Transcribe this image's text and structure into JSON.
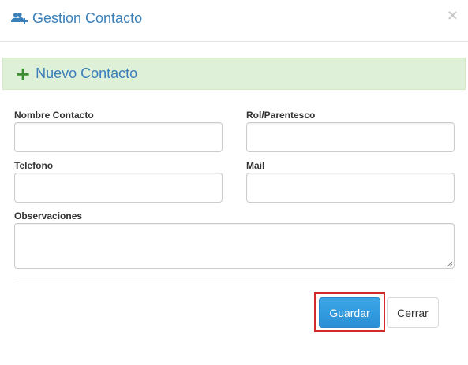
{
  "modal": {
    "title": "Gestion Contacto",
    "title_icon": "add-user-icon",
    "close_label": "×"
  },
  "panel": {
    "heading": "Nuevo Contacto",
    "heading_icon": "plus-icon",
    "heading_icon_glyph": "+"
  },
  "form": {
    "nombre_label": "Nombre Contacto",
    "nombre_value": "",
    "rol_label": "Rol/Parentesco",
    "rol_value": "",
    "telefono_label": "Telefono",
    "telefono_value": "",
    "mail_label": "Mail",
    "mail_value": "",
    "observaciones_label": "Observaciones",
    "observaciones_value": ""
  },
  "buttons": {
    "guardar_label": "Guardar",
    "cerrar_label": "Cerrar"
  },
  "colors": {
    "accent": "#3a7fb8",
    "panel_bg": "#dff0d8",
    "plus_green": "#3c8d2f",
    "primary_button": "#2b8fd6",
    "highlight": "#d42a2a"
  }
}
